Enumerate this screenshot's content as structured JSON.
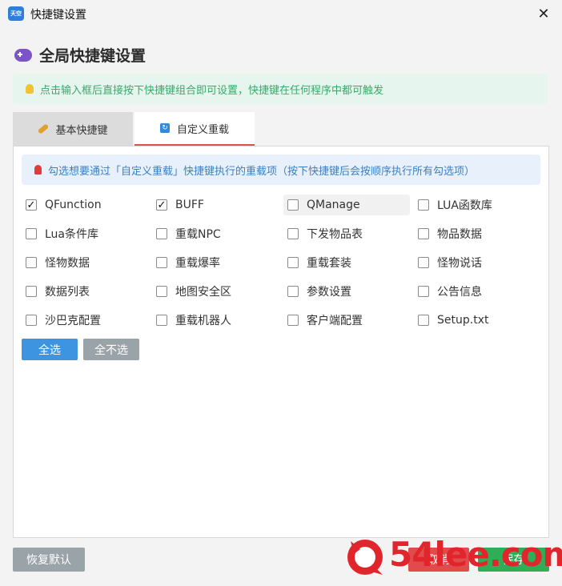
{
  "window": {
    "title": "快捷键设置",
    "app_icon_text": "天空"
  },
  "header": {
    "title": "全局快捷键设置"
  },
  "hint": "点击输入框后直接按下快捷键组合即可设置，快捷键在任何程序中都可触发",
  "tabs": [
    {
      "label": "基本快捷键",
      "active": false
    },
    {
      "label": "自定义重载",
      "active": true
    }
  ],
  "info": "勾选想要通过「自定义重载」快捷键执行的重载项（按下快捷键后会按顺序执行所有勾选项）",
  "items": [
    {
      "label": "QFunction",
      "checked": true
    },
    {
      "label": "BUFF",
      "checked": true
    },
    {
      "label": "QManage",
      "checked": false
    },
    {
      "label": "LUA函数库",
      "checked": false
    },
    {
      "label": "Lua条件库",
      "checked": false
    },
    {
      "label": "重载NPC",
      "checked": false
    },
    {
      "label": "下发物品表",
      "checked": false
    },
    {
      "label": "物品数据",
      "checked": false
    },
    {
      "label": "怪物数据",
      "checked": false
    },
    {
      "label": "重载爆率",
      "checked": false
    },
    {
      "label": "重载套装",
      "checked": false
    },
    {
      "label": "怪物说话",
      "checked": false
    },
    {
      "label": "数据列表",
      "checked": false
    },
    {
      "label": "地图安全区",
      "checked": false
    },
    {
      "label": "参数设置",
      "checked": false
    },
    {
      "label": "公告信息",
      "checked": false
    },
    {
      "label": "沙巴克配置",
      "checked": false
    },
    {
      "label": "重载机器人",
      "checked": false
    },
    {
      "label": "客户端配置",
      "checked": false
    },
    {
      "label": "Setup.txt",
      "checked": false
    }
  ],
  "buttons": {
    "select_all": "全选",
    "select_none": "全不选",
    "restore": "恢复默认",
    "cancel": "取消",
    "save": "保存"
  },
  "watermark": "54lee.com",
  "icons": {
    "close": "close-icon",
    "header": "gamepad-icon",
    "hint": "lightbulb-icon",
    "tab_basic": "key-icon",
    "tab_custom": "reload-icon",
    "info": "pin-icon"
  },
  "colors": {
    "primary": "#3d94e0",
    "danger": "#e14b4b",
    "success": "#2fae57",
    "muted": "#9aa3a8",
    "hint_bg": "#e6f6ee",
    "hint_text": "#39a86b",
    "info_bg": "#e8f1fb",
    "info_text": "#3a7fc4",
    "tab_underline": "#e05050"
  }
}
